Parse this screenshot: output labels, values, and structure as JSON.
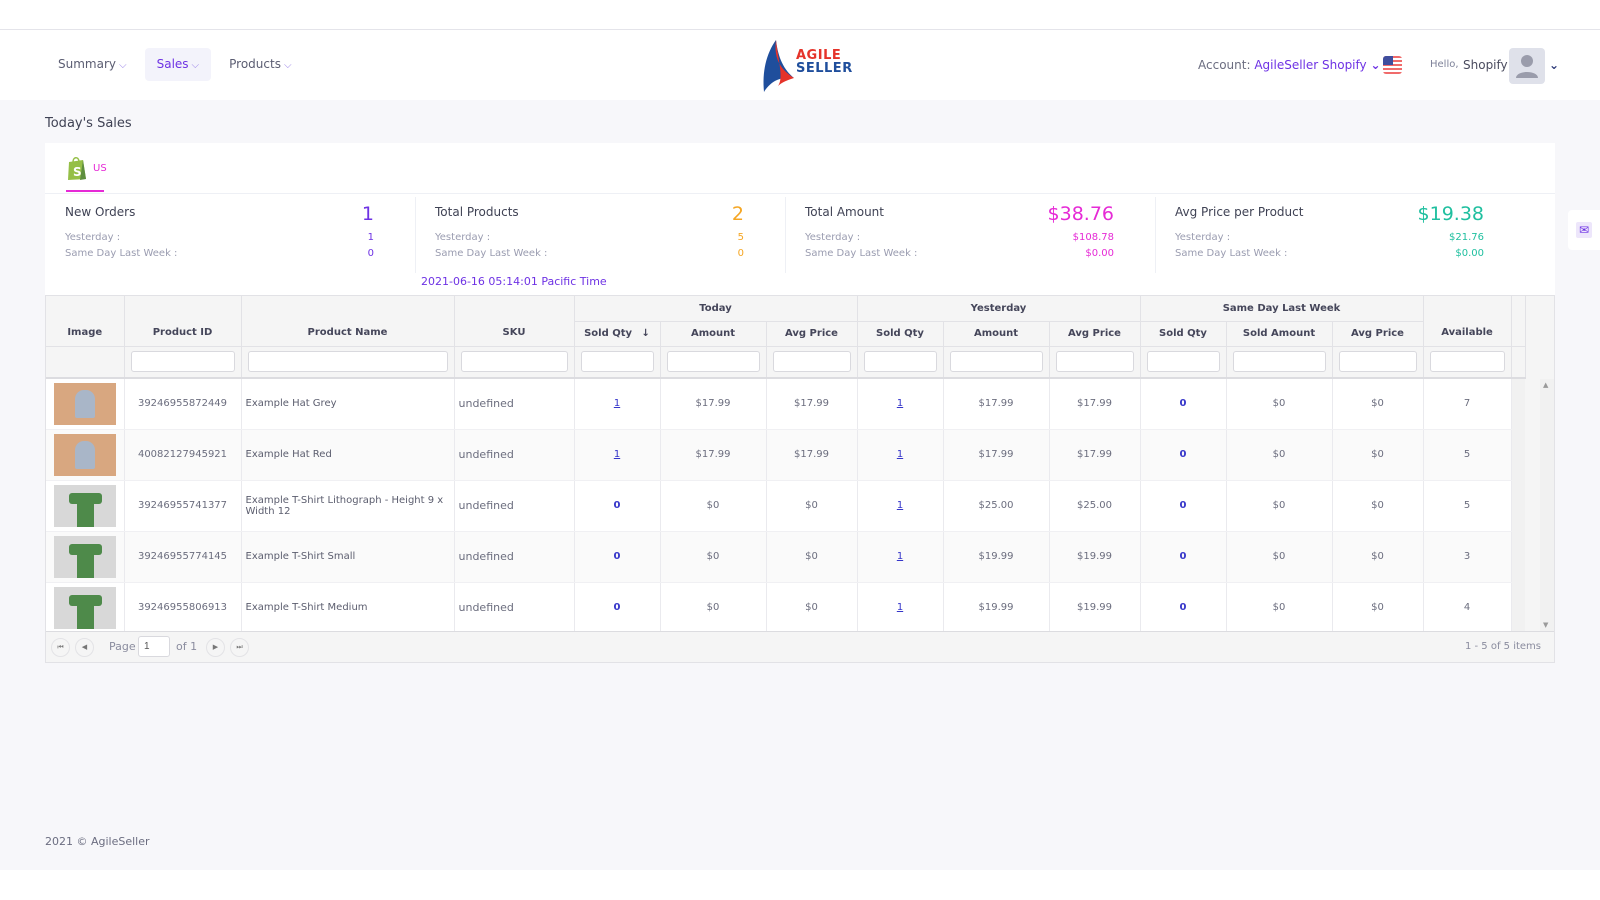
{
  "nav": {
    "items": [
      {
        "label": "Summary",
        "active": false
      },
      {
        "label": "Sales",
        "active": true
      },
      {
        "label": "Products",
        "active": false
      }
    ],
    "logo": {
      "line1": "AGILE",
      "line2": "SELLER"
    },
    "account_label": "Account:",
    "account_value": "AgileSeller Shopify",
    "hello_label": "Hello,",
    "user_name": "Shopify"
  },
  "page": {
    "title": "Today's Sales",
    "tab_label": "US",
    "timestamp": "2021-06-16 05:14:01 Pacific Time"
  },
  "stats": [
    {
      "title": "New Orders",
      "value": "1",
      "yesterday_label": "Yesterday :",
      "yesterday": "1",
      "last_week_label": "Same Day Last Week :",
      "last_week": "0",
      "color": "#6e32e4"
    },
    {
      "title": "Total Products",
      "value": "2",
      "yesterday_label": "Yesterday :",
      "yesterday": "5",
      "last_week_label": "Same Day Last Week :",
      "last_week": "0",
      "color": "#f5a623"
    },
    {
      "title": "Total Amount",
      "value": "$38.76",
      "yesterday_label": "Yesterday :",
      "yesterday": "$108.78",
      "last_week_label": "Same Day Last Week :",
      "last_week": "$0.00",
      "color": "#e62ad6"
    },
    {
      "title": "Avg Price per Product",
      "value": "$19.38",
      "yesterday_label": "Yesterday :",
      "yesterday": "$21.76",
      "last_week_label": "Same Day Last Week :",
      "last_week": "$0.00",
      "color": "#1fbf9f"
    }
  ],
  "table": {
    "groups": [
      "Today",
      "Yesterday",
      "Same Day Last Week"
    ],
    "columns": [
      "Image",
      "Product ID",
      "Product Name",
      "SKU",
      "Sold Qty",
      "Amount",
      "Avg Price",
      "Sold Qty",
      "Amount",
      "Avg Price",
      "Sold Qty",
      "Sold Amount",
      "Avg Price",
      "Available"
    ],
    "sort_indicator": "↓",
    "rows": [
      {
        "image": "hat",
        "id": "39246955872449",
        "name": "Example Hat Grey",
        "sku": "undefined",
        "t_qty": "1",
        "t_amt": "$17.99",
        "t_avg": "$17.99",
        "y_qty": "1",
        "y_amt": "$17.99",
        "y_avg": "$17.99",
        "w_qty": "0",
        "w_amt": "$0",
        "w_avg": "$0",
        "available": "7"
      },
      {
        "image": "hat",
        "id": "40082127945921",
        "name": "Example Hat Red",
        "sku": "undefined",
        "t_qty": "1",
        "t_amt": "$17.99",
        "t_avg": "$17.99",
        "y_qty": "1",
        "y_amt": "$17.99",
        "y_avg": "$17.99",
        "w_qty": "0",
        "w_amt": "$0",
        "w_avg": "$0",
        "available": "5"
      },
      {
        "image": "shirt",
        "id": "39246955741377",
        "name": "Example T-Shirt Lithograph - Height 9 x Width 12",
        "sku": "undefined",
        "t_qty": "0",
        "t_amt": "$0",
        "t_avg": "$0",
        "y_qty": "1",
        "y_amt": "$25.00",
        "y_avg": "$25.00",
        "w_qty": "0",
        "w_amt": "$0",
        "w_avg": "$0",
        "available": "5"
      },
      {
        "image": "shirt",
        "id": "39246955774145",
        "name": "Example T-Shirt Small",
        "sku": "undefined",
        "t_qty": "0",
        "t_amt": "$0",
        "t_avg": "$0",
        "y_qty": "1",
        "y_amt": "$19.99",
        "y_avg": "$19.99",
        "w_qty": "0",
        "w_amt": "$0",
        "w_avg": "$0",
        "available": "3"
      },
      {
        "image": "shirt",
        "id": "39246955806913",
        "name": "Example T-Shirt Medium",
        "sku": "undefined",
        "t_qty": "0",
        "t_amt": "$0",
        "t_avg": "$0",
        "y_qty": "1",
        "y_amt": "$19.99",
        "y_avg": "$19.99",
        "w_qty": "0",
        "w_amt": "$0",
        "w_avg": "$0",
        "available": "4"
      }
    ]
  },
  "pager": {
    "page_label": "Page",
    "page_value": "1",
    "of_label": "of 1",
    "info": "1 - 5 of 5 items"
  },
  "footer": {
    "text": "2021 © AgileSeller"
  }
}
